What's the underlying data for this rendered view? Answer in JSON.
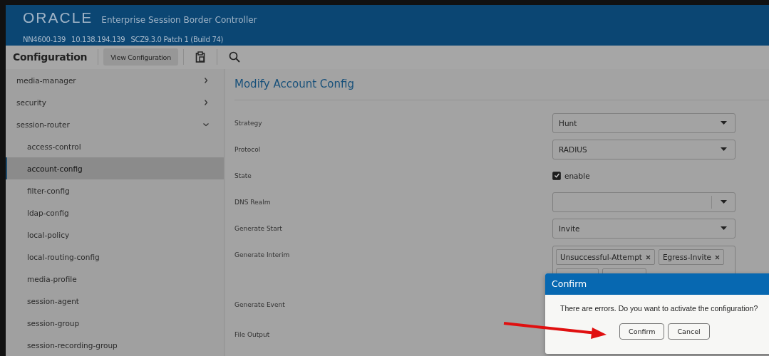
{
  "header": {
    "logo": "ORACLE",
    "product": "Enterprise Session Border Controller",
    "system_info": [
      "NN4600-139",
      "10.138.194.139",
      "SCZ9.3.0 Patch 1 (Build 74)"
    ]
  },
  "toolbar": {
    "title": "Configuration",
    "view_button": "View Configuration"
  },
  "sidebar": {
    "items": [
      {
        "label": "media-manager",
        "expanded": false,
        "selected": false
      },
      {
        "label": "security",
        "expanded": false,
        "selected": false
      },
      {
        "label": "session-router",
        "expanded": true,
        "selected": false,
        "children": [
          {
            "label": "access-control",
            "selected": false
          },
          {
            "label": "account-config",
            "selected": true
          },
          {
            "label": "filter-config",
            "selected": false
          },
          {
            "label": "ldap-config",
            "selected": false
          },
          {
            "label": "local-policy",
            "selected": false
          },
          {
            "label": "local-routing-config",
            "selected": false
          },
          {
            "label": "media-profile",
            "selected": false
          },
          {
            "label": "session-agent",
            "selected": false
          },
          {
            "label": "session-group",
            "selected": false
          },
          {
            "label": "session-recording-group",
            "selected": false
          }
        ]
      }
    ]
  },
  "form": {
    "title": "Modify Account Config",
    "fields": [
      {
        "kind": "select",
        "label": "Strategy",
        "value": "Hunt"
      },
      {
        "kind": "select",
        "label": "Protocol",
        "value": "RADIUS"
      },
      {
        "kind": "checkbox",
        "label": "State",
        "option": "enable",
        "checked": true
      },
      {
        "kind": "combo",
        "label": "DNS Realm"
      },
      {
        "kind": "select",
        "label": "Generate Start",
        "value": "Invite"
      },
      {
        "kind": "tags",
        "label": "Generate Interim",
        "tags": [
          "Unsuccessful-Attempt",
          "Egress-Invite"
        ]
      },
      {
        "kind": "covered",
        "label": "Generate Event"
      },
      {
        "kind": "covered",
        "label": "File Output"
      }
    ]
  },
  "dialog": {
    "title": "Confirm",
    "message": "There are errors. Do you want to activate the configuration?",
    "buttons": [
      "Confirm",
      "Cancel"
    ]
  }
}
